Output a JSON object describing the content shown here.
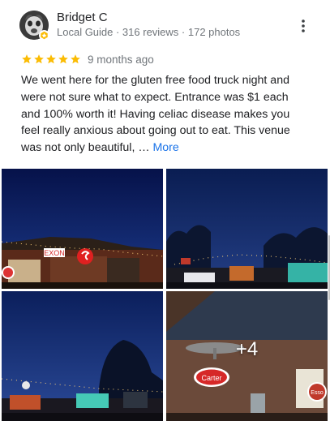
{
  "reviewer": {
    "name": "Bridget C",
    "meta": "Local Guide · 316 reviews · 172 photos",
    "avatar_icon": "reviewer-avatar",
    "badge_icon": "local-guide-badge-icon"
  },
  "review": {
    "rating": 5,
    "time": "9 months ago",
    "lines": [
      "We went here for the gluten free food truck night and",
      "were not sure what to expect.  Entrance was $1 each",
      "and 100% worth it!  Having celiac disease makes you",
      "feel really anxious about going out to eat.  This venue",
      "was not only beautiful, … "
    ],
    "more_label": "More"
  },
  "photos": {
    "extra_count": "+4",
    "signs": {
      "exxon": "EXON",
      "carter": "Carter",
      "esso": "Esso"
    }
  },
  "colors": {
    "star": "#fbbc04",
    "link": "#1a73e8",
    "meta_text": "#70757a",
    "night_sky": "#0a1b4d"
  }
}
